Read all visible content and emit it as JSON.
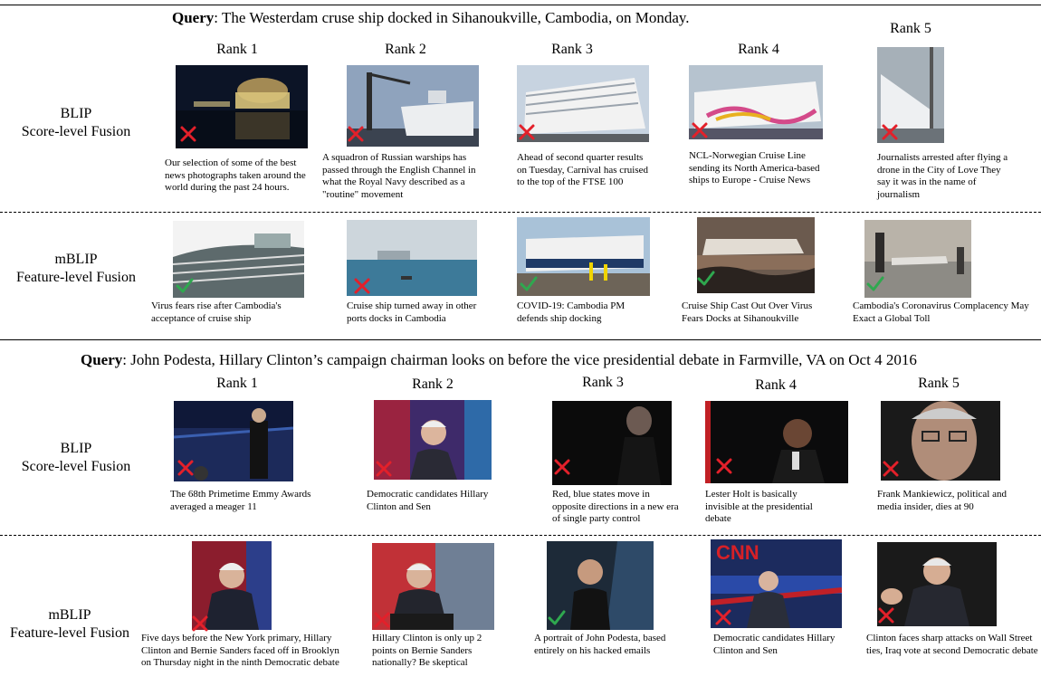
{
  "colors": {
    "cross": "#e3202a",
    "check": "#2fa84f"
  },
  "queries": [
    {
      "label": "Query",
      "text": ": The Westerdam cruse ship docked in Sihanoukville, Cambodia, on Monday.",
      "ranks": [
        "Rank 1",
        "Rank 2",
        "Rank 3",
        "Rank 4",
        "Rank 5"
      ],
      "rows": [
        {
          "method_line1": "BLIP",
          "method_line2": "Score-level Fusion",
          "results": [
            {
              "mark": "cross",
              "caption": "Our selection of some of the best news photographs taken around the world during the past 24 hours."
            },
            {
              "mark": "cross",
              "caption": "A squadron of Russian warships has passed through the English Channel in what the Royal Navy described as a \"routine\" movement"
            },
            {
              "mark": "cross",
              "caption": "Ahead of second quarter results on Tuesday, Carnival has cruised to the top of the FTSE 100"
            },
            {
              "mark": "cross",
              "caption": "NCL-Norwegian Cruise Line sending its North America-based ships to Europe - Cruise News"
            },
            {
              "mark": "cross",
              "caption": "Journalists arrested after flying a drone in the City of Love They say it was in the name of journalism"
            }
          ]
        },
        {
          "method_line1": "mBLIP",
          "method_line2": "Feature-level Fusion",
          "results": [
            {
              "mark": "check",
              "caption": "Virus fears rise after Cambodia's acceptance of cruise ship"
            },
            {
              "mark": "cross",
              "caption": "Cruise ship turned away in other ports docks in Cambodia"
            },
            {
              "mark": "check",
              "caption": "COVID-19: Cambodia PM defends ship docking"
            },
            {
              "mark": "check",
              "caption": "Cruise Ship Cast Out Over Virus Fears Docks at Sihanoukville"
            },
            {
              "mark": "check",
              "caption": "Cambodia's Coronavirus Complacency May Exact a Global Toll"
            }
          ]
        }
      ]
    },
    {
      "label": "Query",
      "text": ": John Podesta, Hillary Clinton’s campaign chairman looks on before the vice presidential debate in Farmville, VA on Oct 4 2016",
      "ranks": [
        "Rank 1",
        "Rank 2",
        "Rank 3",
        "Rank 4",
        "Rank 5"
      ],
      "rows": [
        {
          "method_line1": "BLIP",
          "method_line2": "Score-level Fusion",
          "results": [
            {
              "mark": "cross",
              "caption": "The 68th Primetime Emmy Awards averaged a meager 11"
            },
            {
              "mark": "cross",
              "caption": "Democratic candidates Hillary Clinton and Sen"
            },
            {
              "mark": "cross",
              "caption": "Red, blue states move in opposite directions in a new era of single party control"
            },
            {
              "mark": "cross",
              "caption": "Lester Holt is basically invisible at the presidential debate"
            },
            {
              "mark": "cross",
              "caption": "Frank Mankiewicz, political and media insider, dies at 90"
            }
          ]
        },
        {
          "method_line1": "mBLIP",
          "method_line2": "Feature-level Fusion",
          "results": [
            {
              "mark": "cross",
              "caption": "Five days before the New York primary, Hillary Clinton and Bernie Sanders faced off in Brooklyn on Thursday night in the ninth Democratic debate"
            },
            {
              "mark": "cross",
              "caption": "Hillary Clinton is only up 2 points on Bernie Sanders nationally? Be skeptical"
            },
            {
              "mark": "check",
              "caption": "A portrait of John Podesta, based entirely on his hacked emails"
            },
            {
              "mark": "cross",
              "caption": "Democratic candidates Hillary Clinton and Sen"
            },
            {
              "mark": "cross",
              "caption": "Clinton faces sharp attacks on Wall Street ties, Iraq vote at second Democratic debate"
            }
          ],
          "logo_text": "CNN"
        }
      ]
    }
  ]
}
